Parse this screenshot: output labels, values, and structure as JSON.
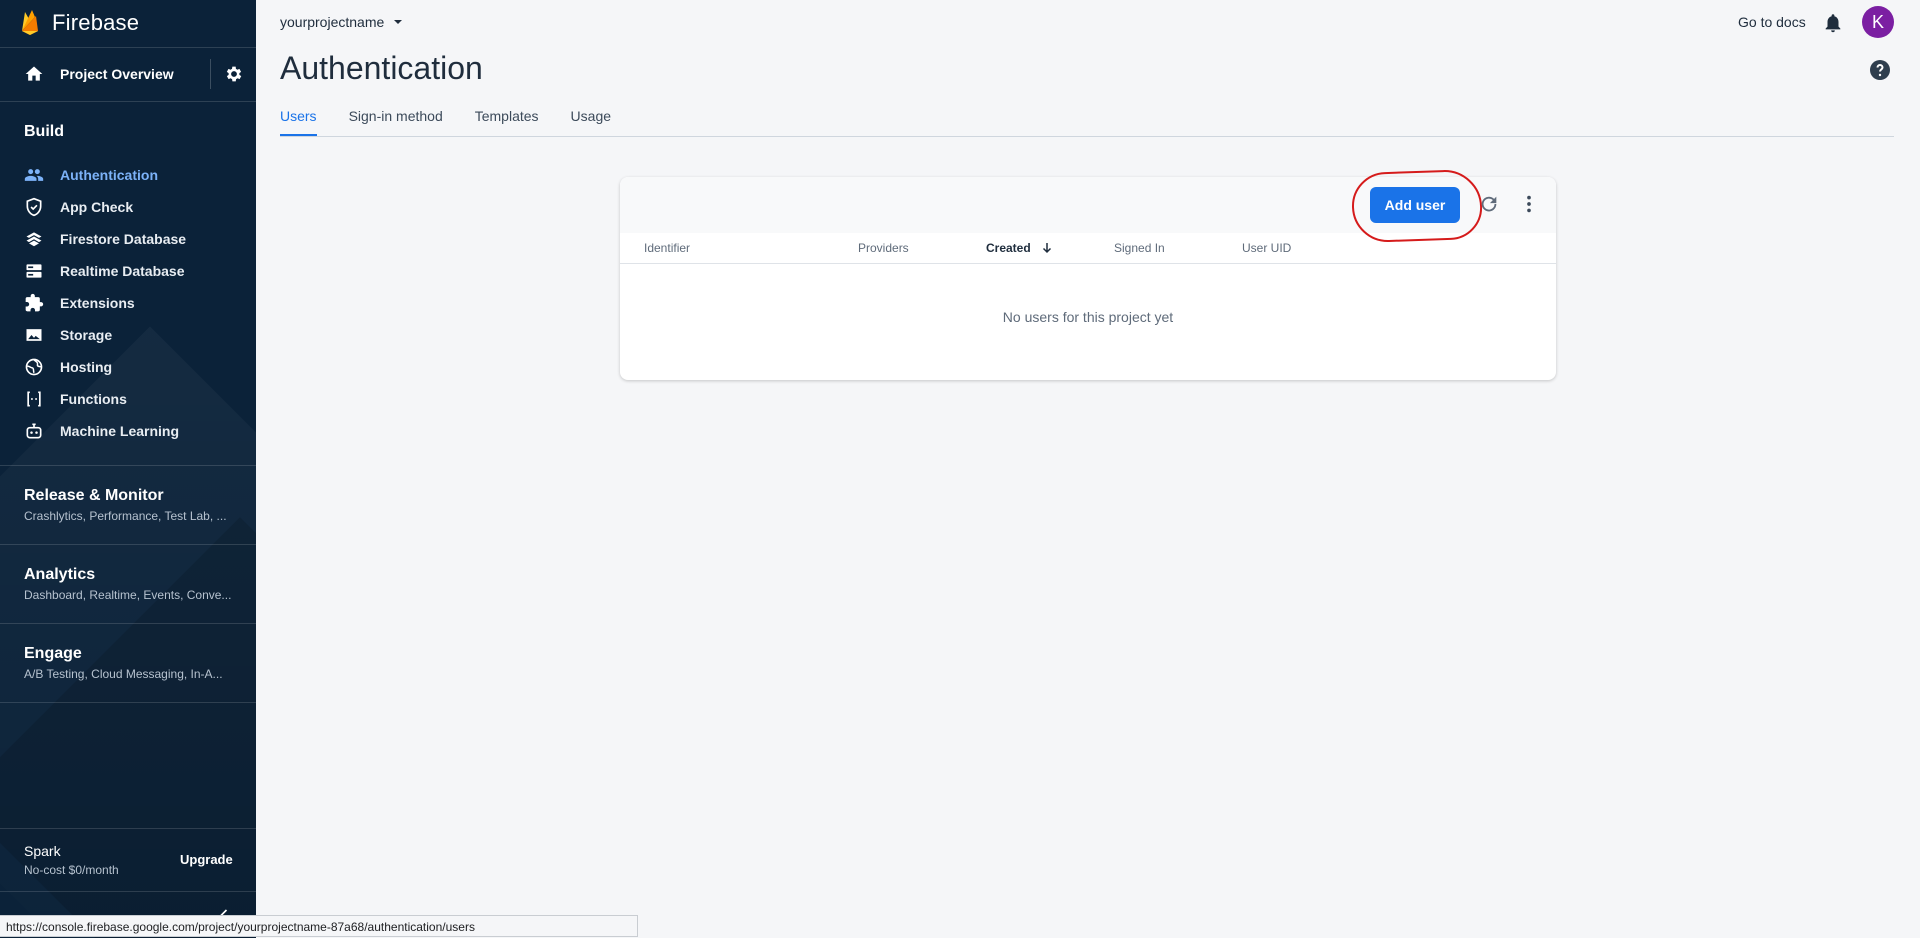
{
  "app": {
    "name": "Firebase"
  },
  "sidebar": {
    "overview_label": "Project Overview",
    "build": {
      "title": "Build",
      "items": [
        {
          "label": "Authentication",
          "icon": "people-icon",
          "active": true
        },
        {
          "label": "App Check",
          "icon": "shield-check-icon",
          "active": false
        },
        {
          "label": "Firestore Database",
          "icon": "firestore-icon",
          "active": false
        },
        {
          "label": "Realtime Database",
          "icon": "database-icon",
          "active": false
        },
        {
          "label": "Extensions",
          "icon": "extensions-icon",
          "active": false
        },
        {
          "label": "Storage",
          "icon": "image-icon",
          "active": false
        },
        {
          "label": "Hosting",
          "icon": "globe-icon",
          "active": false
        },
        {
          "label": "Functions",
          "icon": "functions-icon",
          "active": false
        },
        {
          "label": "Machine Learning",
          "icon": "robot-icon",
          "active": false
        }
      ]
    },
    "release": {
      "title": "Release & Monitor",
      "subtitle": "Crashlytics, Performance, Test Lab, ..."
    },
    "analytics": {
      "title": "Analytics",
      "subtitle": "Dashboard, Realtime, Events, Conve..."
    },
    "engage": {
      "title": "Engage",
      "subtitle": "A/B Testing, Cloud Messaging, In-A..."
    },
    "plan": {
      "name": "Spark",
      "subtitle": "No-cost $0/month",
      "upgrade_label": "Upgrade"
    }
  },
  "header": {
    "project_name": "yourprojectname",
    "docs_label": "Go to docs",
    "avatar_initial": "K",
    "page_title": "Authentication"
  },
  "tabs": [
    {
      "label": "Users",
      "active": true
    },
    {
      "label": "Sign-in method",
      "active": false
    },
    {
      "label": "Templates",
      "active": false
    },
    {
      "label": "Usage",
      "active": false
    }
  ],
  "users_table": {
    "add_user_label": "Add user",
    "columns": [
      "Identifier",
      "Providers",
      "Created",
      "Signed In",
      "User UID"
    ],
    "sorted_column": "Created",
    "empty_message": "No users for this project yet"
  },
  "status_bar": {
    "url": "https://console.firebase.google.com/project/yourprojectname-87a68/authentication/users"
  },
  "colors": {
    "sidebar_bg": "#0b2239",
    "accent": "#1a73e8",
    "active_nav": "#7cb2f8",
    "avatar": "#7b1fa2",
    "annotation": "#d51b1b"
  }
}
